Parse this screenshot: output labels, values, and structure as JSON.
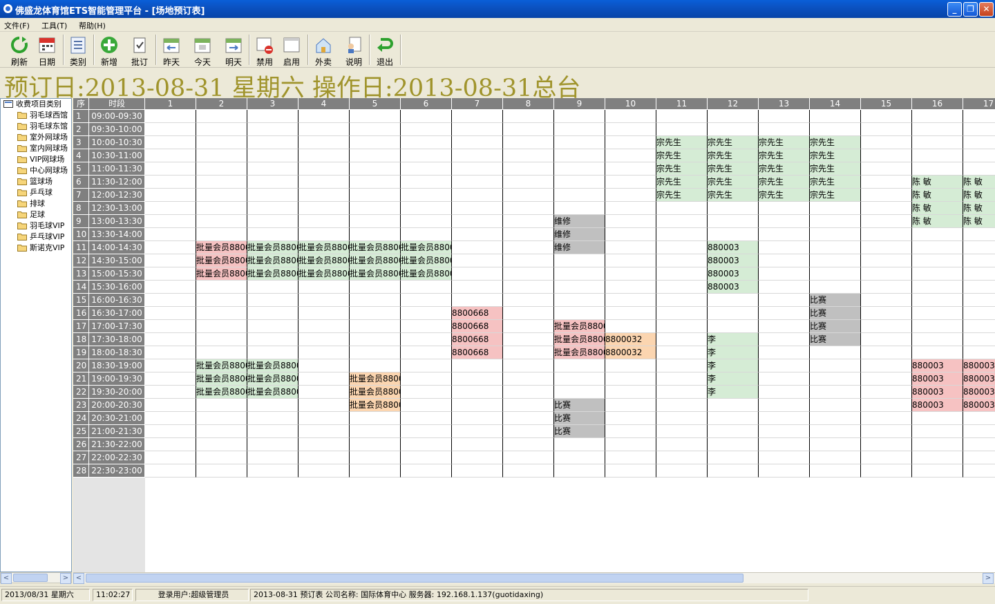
{
  "window": {
    "title": "佛盛龙体育馆ETS智能管理平台 - [场地预订表]",
    "minimize": "_",
    "restore": "❐",
    "close": "✕"
  },
  "menu": [
    "文件(F)",
    "工具(T)",
    "帮助(H)"
  ],
  "toolbar": [
    {
      "label": "刷新",
      "icon": "refresh-icon"
    },
    {
      "label": "日期",
      "icon": "calendar-icon"
    },
    {
      "label": "类别",
      "icon": "category-list-icon"
    },
    {
      "label": "新增",
      "icon": "add-icon"
    },
    {
      "label": "批订",
      "icon": "batch-booking-icon"
    },
    {
      "label": "昨天",
      "icon": "yesterday-icon"
    },
    {
      "label": "今天",
      "icon": "today-icon"
    },
    {
      "label": "明天",
      "icon": "tomorrow-icon"
    },
    {
      "label": "禁用",
      "icon": "disable-icon"
    },
    {
      "label": "启用",
      "icon": "enable-icon"
    },
    {
      "label": "外卖",
      "icon": "takeout-icon"
    },
    {
      "label": "说明",
      "icon": "help-icon"
    },
    {
      "label": "退出",
      "icon": "exit-icon"
    }
  ],
  "date_banner": "预订日:2013-08-31 星期六  操作日:2013-08-31总台",
  "tree": {
    "root": "收费项目类别",
    "items": [
      "羽毛球西馆",
      "羽毛球东馆",
      "室外网球场",
      "室内网球场",
      "VIP网球场",
      "中心网球场",
      "篮球场",
      "乒乓球",
      "排球",
      "足球",
      "羽毛球VIP",
      "乒乓球VIP",
      "斯诺克VIP"
    ]
  },
  "grid": {
    "seq_header": "序",
    "time_header": "时段",
    "courts": [
      "1",
      "2",
      "3",
      "4",
      "5",
      "6",
      "7",
      "8",
      "9",
      "10",
      "11",
      "12",
      "13",
      "14",
      "15",
      "16",
      "17"
    ],
    "slots": [
      "09:00-09:30",
      "09:30-10:00",
      "10:00-10:30",
      "10:30-11:00",
      "11:00-11:30",
      "11:30-12:00",
      "12:00-12:30",
      "12:30-13:00",
      "13:00-13:30",
      "13:30-14:00",
      "14:00-14:30",
      "14:30-15:00",
      "15:00-15:30",
      "15:30-16:00",
      "16:00-16:30",
      "16:30-17:00",
      "17:00-17:30",
      "17:30-18:00",
      "18:00-18:30",
      "18:30-19:00",
      "19:00-19:30",
      "19:30-20:00",
      "20:00-20:30",
      "20:30-21:00",
      "21:00-21:30",
      "21:30-22:00",
      "22:00-22:30",
      "22:30-23:00"
    ],
    "status_colors": {
      "green": "#d5ecd5",
      "red": "#f6c2c2",
      "gray": "#c0c0c0",
      "orange": "#fbd5b0"
    },
    "bookings": [
      {
        "row": 3,
        "court": 11,
        "text": "宗先生",
        "color": "green"
      },
      {
        "row": 3,
        "court": 12,
        "text": "宗先生",
        "color": "green"
      },
      {
        "row": 3,
        "court": 13,
        "text": "宗先生",
        "color": "green"
      },
      {
        "row": 3,
        "court": 14,
        "text": "宗先生",
        "color": "green"
      },
      {
        "row": 4,
        "court": 11,
        "text": "宗先生",
        "color": "green"
      },
      {
        "row": 4,
        "court": 12,
        "text": "宗先生",
        "color": "green"
      },
      {
        "row": 4,
        "court": 13,
        "text": "宗先生",
        "color": "green"
      },
      {
        "row": 4,
        "court": 14,
        "text": "宗先生",
        "color": "green"
      },
      {
        "row": 5,
        "court": 11,
        "text": "宗先生",
        "color": "green"
      },
      {
        "row": 5,
        "court": 12,
        "text": "宗先生",
        "color": "green"
      },
      {
        "row": 5,
        "court": 13,
        "text": "宗先生",
        "color": "green"
      },
      {
        "row": 5,
        "court": 14,
        "text": "宗先生",
        "color": "green"
      },
      {
        "row": 6,
        "court": 11,
        "text": "宗先生",
        "color": "green"
      },
      {
        "row": 6,
        "court": 12,
        "text": "宗先生",
        "color": "green"
      },
      {
        "row": 6,
        "court": 13,
        "text": "宗先生",
        "color": "green"
      },
      {
        "row": 6,
        "court": 14,
        "text": "宗先生",
        "color": "green"
      },
      {
        "row": 6,
        "court": 16,
        "text": "陈 敏",
        "color": "green"
      },
      {
        "row": 6,
        "court": 17,
        "text": "陈 敏",
        "color": "green"
      },
      {
        "row": 7,
        "court": 11,
        "text": "宗先生",
        "color": "green"
      },
      {
        "row": 7,
        "court": 12,
        "text": "宗先生",
        "color": "green"
      },
      {
        "row": 7,
        "court": 13,
        "text": "宗先生",
        "color": "green"
      },
      {
        "row": 7,
        "court": 14,
        "text": "宗先生",
        "color": "green"
      },
      {
        "row": 7,
        "court": 16,
        "text": "陈 敏",
        "color": "green"
      },
      {
        "row": 7,
        "court": 17,
        "text": "陈 敏",
        "color": "green"
      },
      {
        "row": 8,
        "court": 16,
        "text": "陈 敏",
        "color": "green"
      },
      {
        "row": 8,
        "court": 17,
        "text": "陈 敏",
        "color": "green"
      },
      {
        "row": 9,
        "court": 9,
        "text": "维修",
        "color": "gray"
      },
      {
        "row": 9,
        "court": 16,
        "text": "陈 敏",
        "color": "green"
      },
      {
        "row": 9,
        "court": 17,
        "text": "陈 敏",
        "color": "green"
      },
      {
        "row": 10,
        "court": 9,
        "text": "维修",
        "color": "gray"
      },
      {
        "row": 11,
        "court": 2,
        "text": "批量会员8800",
        "color": "red"
      },
      {
        "row": 11,
        "court": 3,
        "text": "批量会员8800",
        "color": "green"
      },
      {
        "row": 11,
        "court": 4,
        "text": "批量会员8800",
        "color": "green"
      },
      {
        "row": 11,
        "court": 5,
        "text": "批量会员8800",
        "color": "green"
      },
      {
        "row": 11,
        "court": 6,
        "text": "批量会员8800",
        "color": "green"
      },
      {
        "row": 11,
        "court": 9,
        "text": "维修",
        "color": "gray"
      },
      {
        "row": 11,
        "court": 12,
        "text": "880003",
        "color": "green"
      },
      {
        "row": 12,
        "court": 2,
        "text": "批量会员8800",
        "color": "red"
      },
      {
        "row": 12,
        "court": 3,
        "text": "批量会员8800",
        "color": "green"
      },
      {
        "row": 12,
        "court": 4,
        "text": "批量会员8800",
        "color": "green"
      },
      {
        "row": 12,
        "court": 5,
        "text": "批量会员8800",
        "color": "green"
      },
      {
        "row": 12,
        "court": 6,
        "text": "批量会员8800",
        "color": "green"
      },
      {
        "row": 12,
        "court": 12,
        "text": "880003",
        "color": "green"
      },
      {
        "row": 13,
        "court": 2,
        "text": "批量会员8800",
        "color": "red"
      },
      {
        "row": 13,
        "court": 3,
        "text": "批量会员8800",
        "color": "green"
      },
      {
        "row": 13,
        "court": 4,
        "text": "批量会员8800",
        "color": "green"
      },
      {
        "row": 13,
        "court": 5,
        "text": "批量会员8800",
        "color": "green"
      },
      {
        "row": 13,
        "court": 6,
        "text": "批量会员8800",
        "color": "green"
      },
      {
        "row": 13,
        "court": 12,
        "text": "880003",
        "color": "green"
      },
      {
        "row": 14,
        "court": 12,
        "text": "880003",
        "color": "green"
      },
      {
        "row": 15,
        "court": 14,
        "text": "比赛",
        "color": "gray"
      },
      {
        "row": 16,
        "court": 7,
        "text": "8800668",
        "color": "red"
      },
      {
        "row": 16,
        "court": 14,
        "text": "比赛",
        "color": "gray"
      },
      {
        "row": 17,
        "court": 7,
        "text": "8800668",
        "color": "red"
      },
      {
        "row": 17,
        "court": 9,
        "text": "批量会员8800",
        "color": "red"
      },
      {
        "row": 17,
        "court": 14,
        "text": "比赛",
        "color": "gray"
      },
      {
        "row": 18,
        "court": 7,
        "text": "8800668",
        "color": "red"
      },
      {
        "row": 18,
        "court": 9,
        "text": "批量会员8800",
        "color": "red"
      },
      {
        "row": 18,
        "court": 10,
        "text": "8800032",
        "color": "orange"
      },
      {
        "row": 18,
        "court": 12,
        "text": "李",
        "color": "green"
      },
      {
        "row": 18,
        "court": 14,
        "text": "比赛",
        "color": "gray"
      },
      {
        "row": 19,
        "court": 7,
        "text": "8800668",
        "color": "red"
      },
      {
        "row": 19,
        "court": 9,
        "text": "批量会员8800",
        "color": "red"
      },
      {
        "row": 19,
        "court": 10,
        "text": "8800032",
        "color": "orange"
      },
      {
        "row": 19,
        "court": 12,
        "text": "李",
        "color": "green"
      },
      {
        "row": 20,
        "court": 2,
        "text": "批量会员8800",
        "color": "green"
      },
      {
        "row": 20,
        "court": 3,
        "text": "批量会员8800",
        "color": "green"
      },
      {
        "row": 20,
        "court": 12,
        "text": "李",
        "color": "green"
      },
      {
        "row": 20,
        "court": 16,
        "text": "880003",
        "color": "red"
      },
      {
        "row": 20,
        "court": 17,
        "text": "880003",
        "color": "red"
      },
      {
        "row": 21,
        "court": 2,
        "text": "批量会员8800",
        "color": "green"
      },
      {
        "row": 21,
        "court": 3,
        "text": "批量会员8800",
        "color": "green"
      },
      {
        "row": 21,
        "court": 5,
        "text": "批量会员8800",
        "color": "orange"
      },
      {
        "row": 21,
        "court": 12,
        "text": "李",
        "color": "green"
      },
      {
        "row": 21,
        "court": 16,
        "text": "880003",
        "color": "red"
      },
      {
        "row": 21,
        "court": 17,
        "text": "880003",
        "color": "red"
      },
      {
        "row": 22,
        "court": 2,
        "text": "批量会员8800",
        "color": "green"
      },
      {
        "row": 22,
        "court": 3,
        "text": "批量会员8800",
        "color": "green"
      },
      {
        "row": 22,
        "court": 5,
        "text": "批量会员8800",
        "color": "orange"
      },
      {
        "row": 22,
        "court": 12,
        "text": "李",
        "color": "green"
      },
      {
        "row": 22,
        "court": 16,
        "text": "880003",
        "color": "red"
      },
      {
        "row": 22,
        "court": 17,
        "text": "880003",
        "color": "red"
      },
      {
        "row": 23,
        "court": 5,
        "text": "批量会员8800",
        "color": "orange"
      },
      {
        "row": 23,
        "court": 9,
        "text": "比赛",
        "color": "gray"
      },
      {
        "row": 23,
        "court": 16,
        "text": "880003",
        "color": "red"
      },
      {
        "row": 23,
        "court": 17,
        "text": "880003",
        "color": "red"
      },
      {
        "row": 24,
        "court": 9,
        "text": "比赛",
        "color": "gray"
      },
      {
        "row": 25,
        "court": 9,
        "text": "比赛",
        "color": "gray"
      }
    ]
  },
  "status": {
    "date": "2013/08/31 星期六",
    "time": "11:02:27",
    "user": "登录用户:超级管理员",
    "info": "2013-08-31 预订表 公司名称: 国际体育中心 服务器: 192.168.1.137(guotidaxing)"
  }
}
